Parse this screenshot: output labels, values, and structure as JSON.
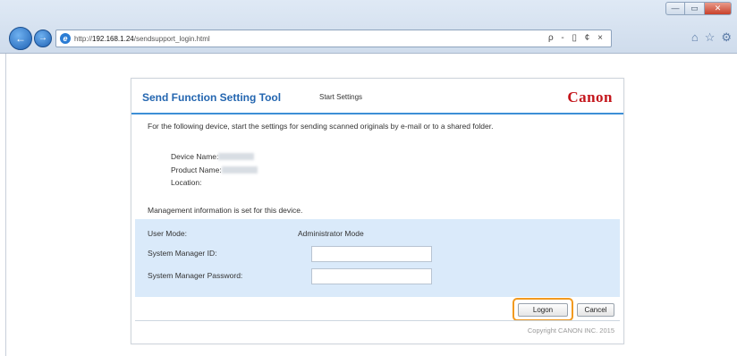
{
  "browser": {
    "url_prefix": "http://",
    "url_host": "192.168.1.24",
    "url_path": "/sendsupport_login.html",
    "address_tools": "ρ - ▯ ¢ ×",
    "window_controls": {
      "minimize": "—",
      "maximize": "▭",
      "close": "✕"
    },
    "tools": {
      "home": "⌂",
      "favorites": "☆",
      "settings": "⚙"
    }
  },
  "header": {
    "title": "Send Function Setting Tool",
    "subtitle": "Start Settings",
    "logo": "Canon"
  },
  "intro": "For the following device, start the settings for sending scanned originals by e-mail or to a shared folder.",
  "device_info": {
    "device_name_label": "Device Name:",
    "product_name_label": "Product Name:",
    "location_label": "Location:"
  },
  "management_notice": "Management information is set for this device.",
  "login": {
    "user_mode_label": "User Mode:",
    "user_mode_value": "Administrator Mode",
    "manager_id_label": "System Manager ID:",
    "manager_id_value": "",
    "password_label": "System Manager Password:",
    "password_value": ""
  },
  "buttons": {
    "logon": "Logon",
    "cancel": "Cancel"
  },
  "footer": {
    "copyright": "Copyright CANON INC. 2015"
  },
  "colors": {
    "accent": "#3d8fd6",
    "title": "#2466b0",
    "brand": "#c4161c",
    "panel": "#daeafa",
    "highlight": "#f29a1f"
  }
}
